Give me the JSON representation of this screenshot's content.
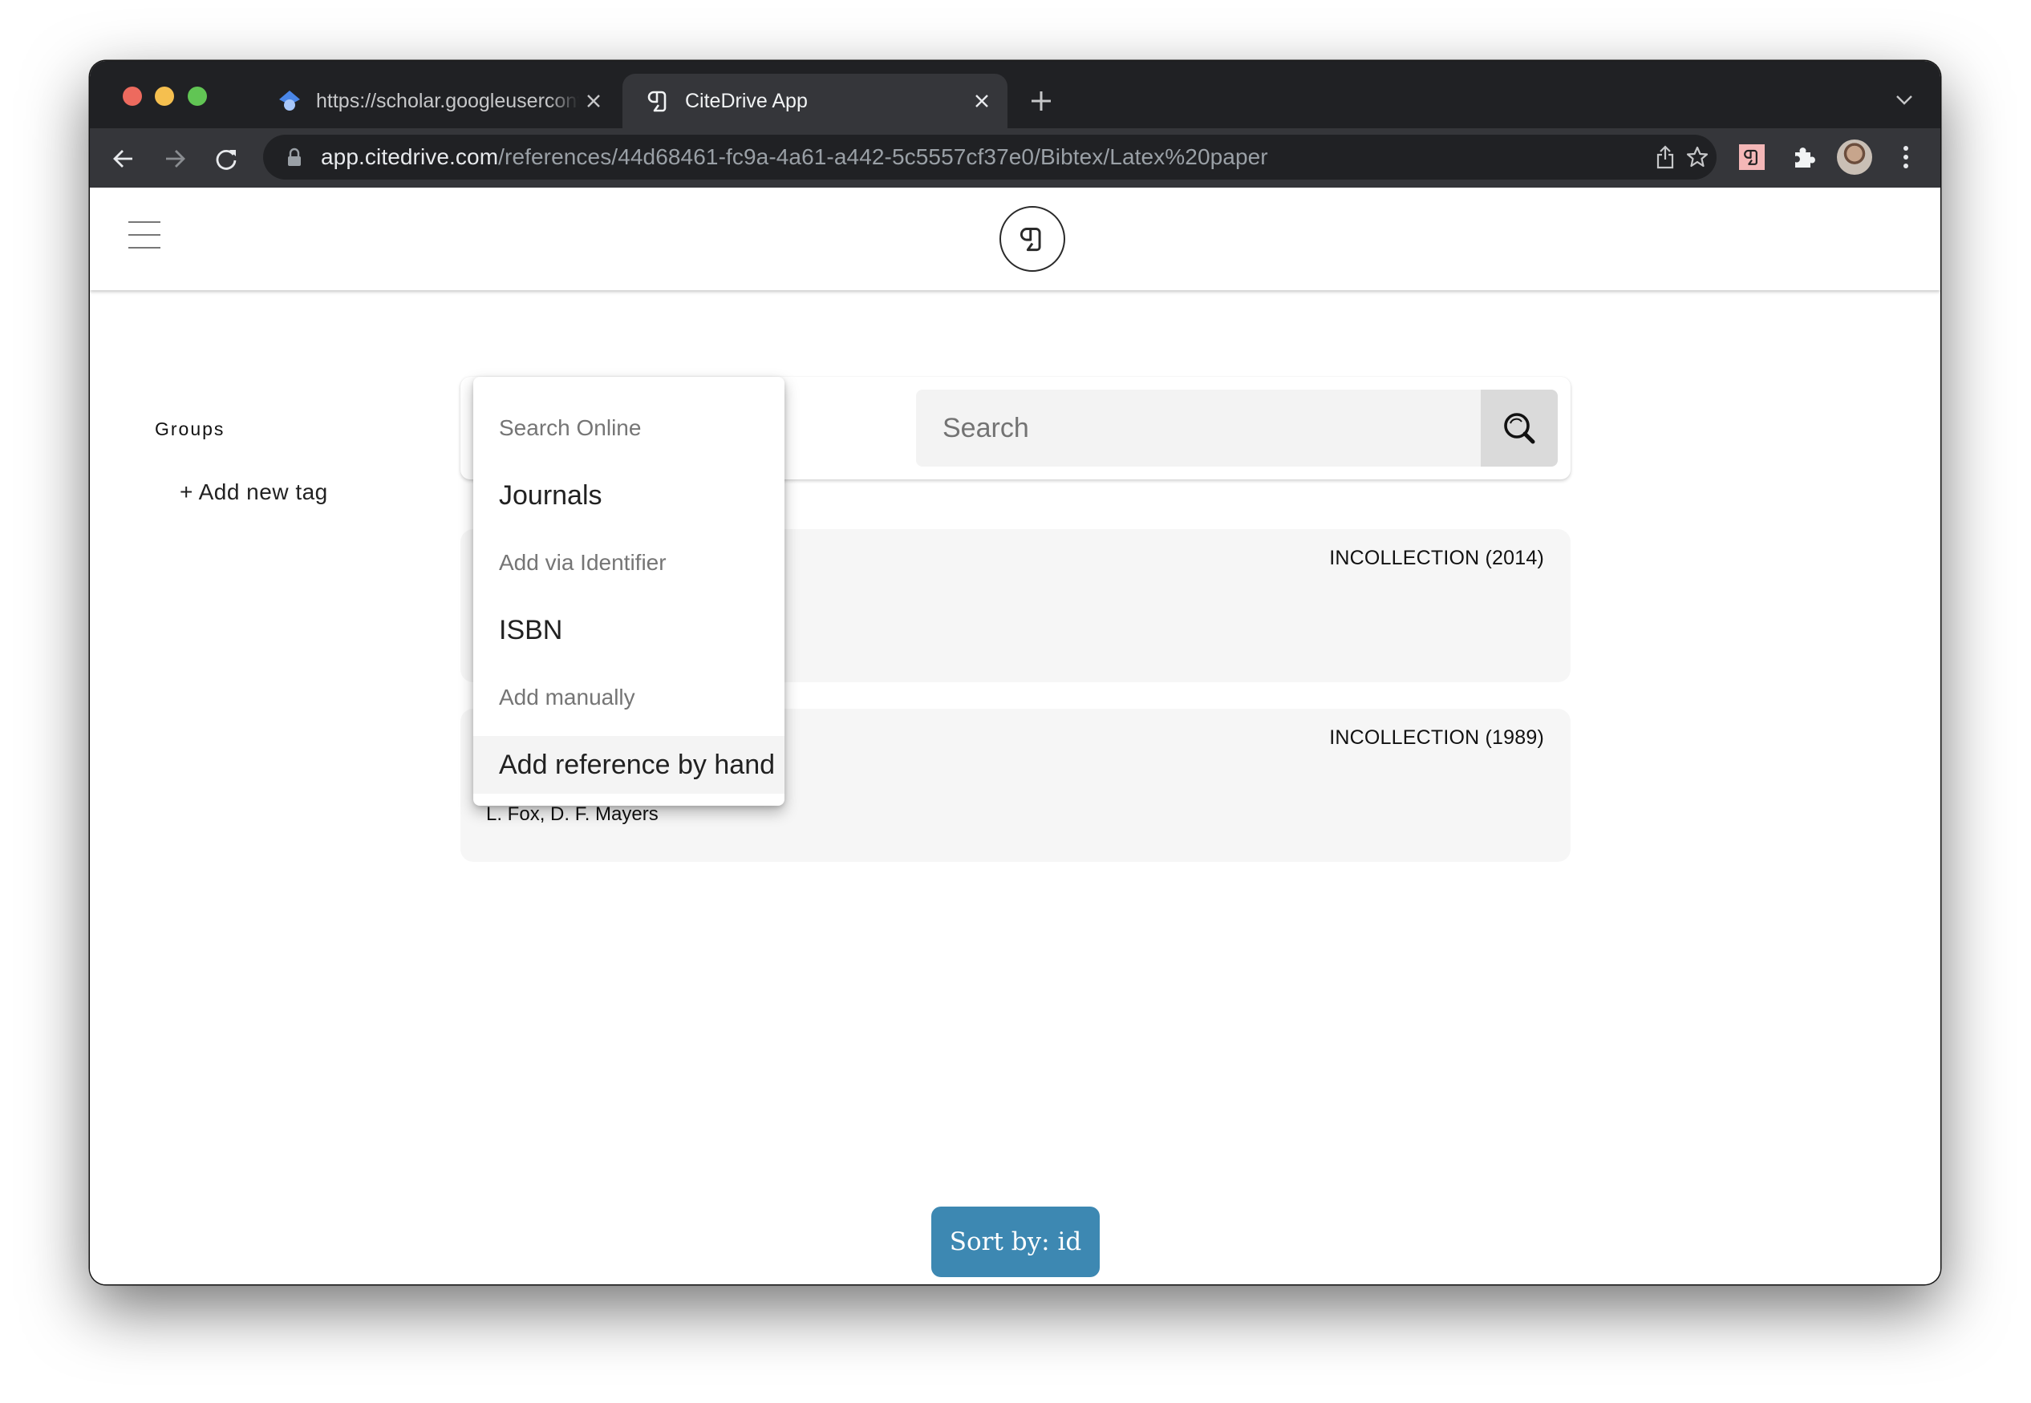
{
  "browser": {
    "tabs": [
      {
        "title": "https://scholar.googleusercontent.com",
        "favicon": "google-scholar-icon",
        "active": false
      },
      {
        "title": "CiteDrive App",
        "favicon": "citedrive-icon",
        "active": true
      }
    ],
    "new_tab_label": "+",
    "address_bar": {
      "host": "app.citedrive.com",
      "path": "/references/44d68461-fc9a-4a61-a442-5c5557cf37e0/Bibtex/Latex%20paper"
    },
    "toolbar_icons": [
      "back-icon",
      "forward-icon",
      "reload-icon",
      "lock-icon",
      "share-icon",
      "bookmark-star-icon",
      "citedrive-extension-icon",
      "extensions-puzzle-icon",
      "profile-avatar",
      "more-menu-icon"
    ]
  },
  "app": {
    "logo": "citedrive-logo",
    "sidebar": {
      "title": "Groups",
      "add_tag_label": "+ Add new tag"
    },
    "search": {
      "placeholder": "Search",
      "value": ""
    },
    "dropdown": {
      "sections": [
        {
          "heading": "Search Online",
          "items": [
            "Journals"
          ]
        },
        {
          "heading": "Add via Identifier",
          "items": [
            "ISBN"
          ]
        },
        {
          "heading": "Add manually",
          "items": [
            "Add reference by hand"
          ]
        }
      ],
      "highlighted_item": "Add reference by hand"
    },
    "references": [
      {
        "type": "INCOLLECTION (2014)",
        "authors": ""
      },
      {
        "type": "INCOLLECTION (1989)",
        "authors": "L. Fox, D. F. Mayers"
      }
    ],
    "sort_button_label": "Sort by: id"
  },
  "colors": {
    "sort_button": "#3d88b2",
    "tab_strip": "#202124",
    "toolbar": "#35363a",
    "card_bg": "#f6f6f6",
    "extension_bg": "#f4b7b7"
  }
}
